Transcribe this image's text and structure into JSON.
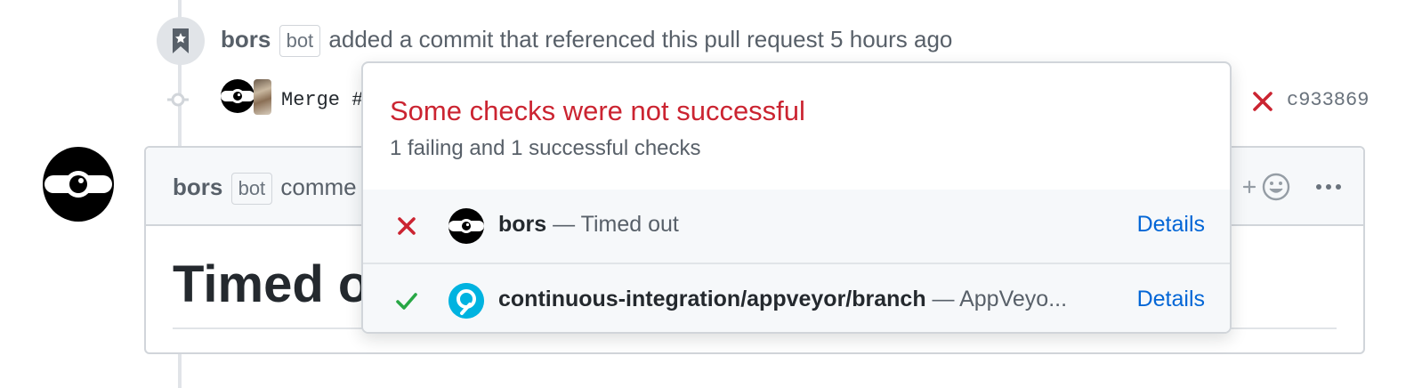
{
  "timeline_event": {
    "author": "bors",
    "bot_label": "bot",
    "action_text": "added a commit that referenced this pull request 5 hours ago"
  },
  "commit": {
    "message": "Merge #",
    "sha": "c933869",
    "status_icon": "x-icon"
  },
  "comment": {
    "author": "bors",
    "bot_label": "bot",
    "action_text": "comme",
    "title": "Timed ou",
    "reaction_icon": "smiley-icon",
    "more_icon": "kebab-horizontal-icon"
  },
  "checks_popover": {
    "title": "Some checks were not successful",
    "summary": "1 failing and 1 successful checks",
    "checks": [
      {
        "status": "failure",
        "status_icon": "x-icon",
        "avatar": "bors-avatar",
        "context": "bors",
        "description": " — Timed out",
        "details_label": "Details"
      },
      {
        "status": "success",
        "status_icon": "check-icon",
        "avatar": "appveyor-avatar",
        "context": "continuous-integration/appveyor/branch",
        "description": " — AppVeyo...",
        "details_label": "Details"
      }
    ]
  },
  "colors": {
    "failure": "#cb2431",
    "success": "#28a745",
    "link": "#0366d6",
    "border": "#d1d5da"
  }
}
